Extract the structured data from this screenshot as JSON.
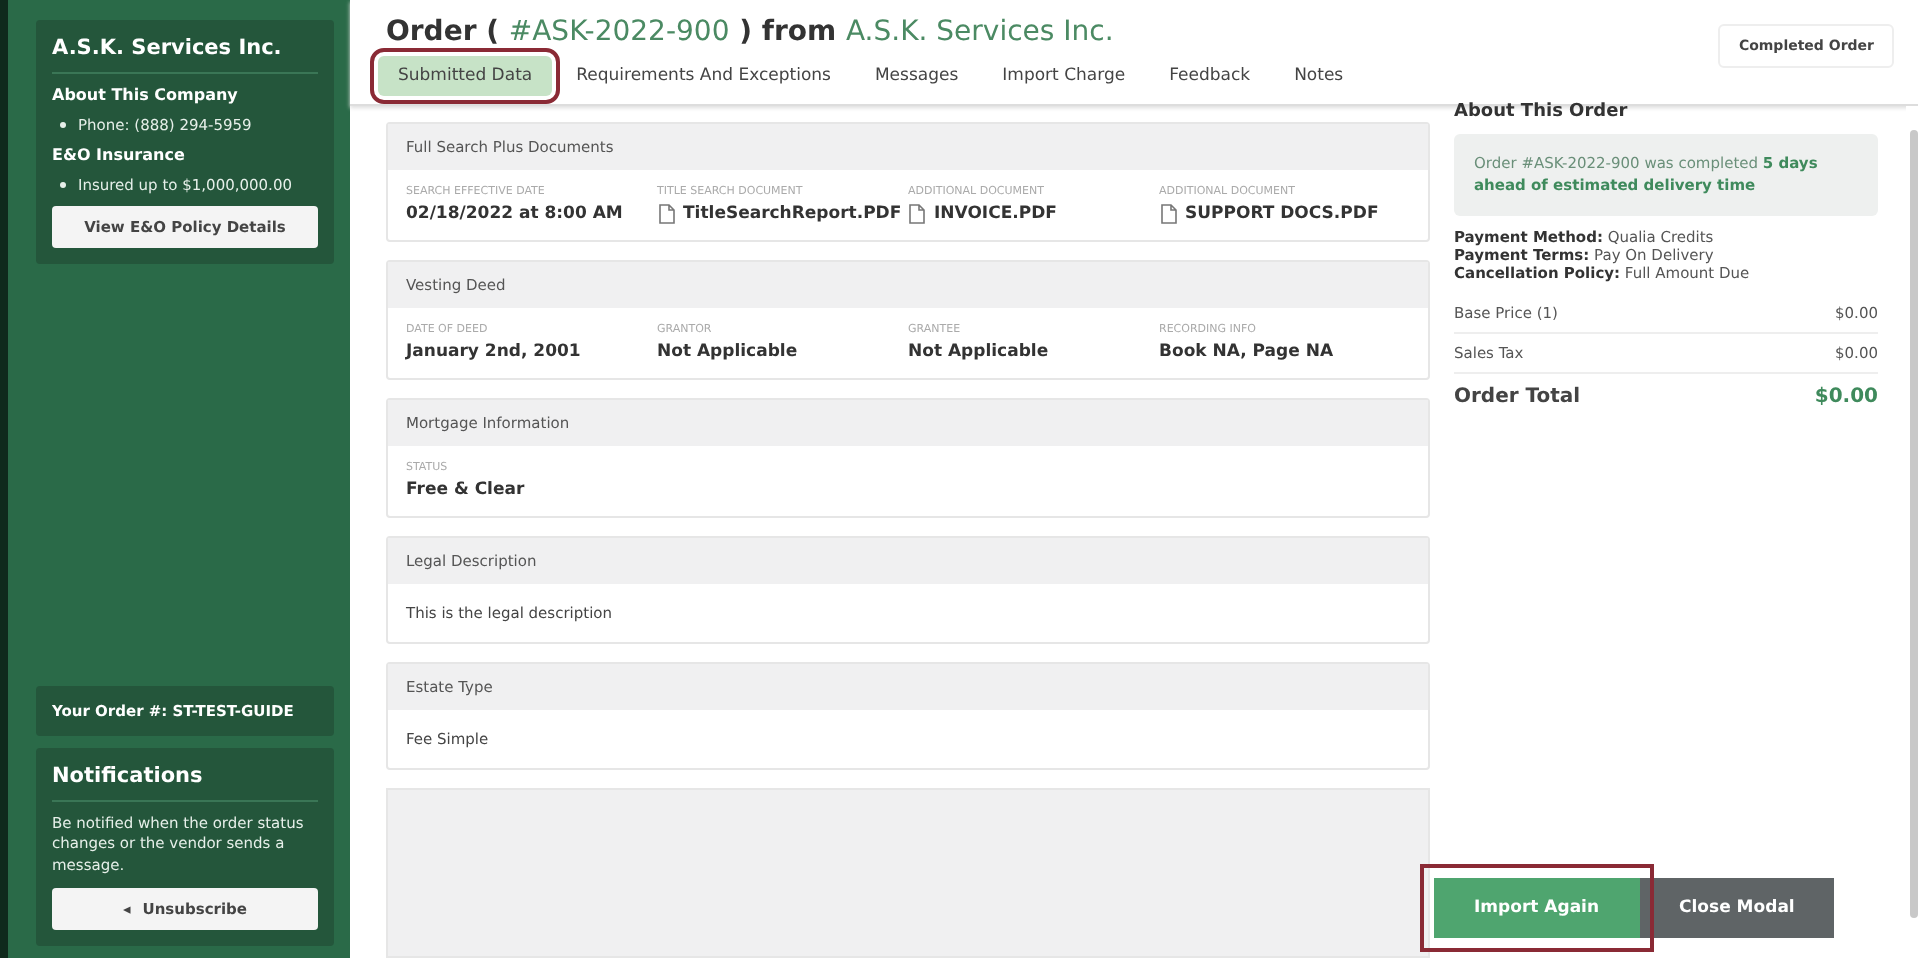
{
  "sidebar": {
    "company": "A.S.K. Services Inc.",
    "sections": [
      {
        "title": "About This Company",
        "items": [
          "Phone: (888) 294-5959"
        ]
      },
      {
        "title": "E&O Insurance",
        "items": [
          "Insured up to $1,000,000.00"
        ]
      }
    ],
    "policy_button": "View E&O Policy Details",
    "your_order": "Your Order #: ST-TEST-GUIDE",
    "notifications": {
      "title": "Notifications",
      "text": "Be notified when the order status changes or the vendor sends a message.",
      "button_icon": "◂",
      "button": "Unsubscribe"
    }
  },
  "header": {
    "title_prefix": "Order (",
    "order_id": "#ASK-2022-900",
    "title_mid": ") from",
    "vendor": "A.S.K. Services Inc.",
    "status": "Completed Order"
  },
  "tabs": [
    {
      "label": "Submitted Data",
      "selected": true,
      "highlighted": true
    },
    {
      "label": "Requirements And Exceptions",
      "selected": false,
      "highlighted": false
    },
    {
      "label": "Messages",
      "selected": false,
      "highlighted": false
    },
    {
      "label": "Import Charge",
      "selected": false,
      "highlighted": false
    },
    {
      "label": "Feedback",
      "selected": false,
      "highlighted": false
    },
    {
      "label": "Notes",
      "selected": false,
      "highlighted": false
    }
  ],
  "sections": [
    {
      "title": "Full Search Plus Documents",
      "kind": "fields",
      "fields": [
        {
          "label": "SEARCH EFFECTIVE DATE",
          "value": "02/18/2022 at 8:00 AM",
          "file": false
        },
        {
          "label": "TITLE SEARCH DOCUMENT",
          "value": "TitleSearchReport.PDF",
          "file": true
        },
        {
          "label": "ADDITIONAL DOCUMENT",
          "value": "INVOICE.PDF",
          "file": true
        },
        {
          "label": "ADDITIONAL DOCUMENT",
          "value": "SUPPORT DOCS.PDF",
          "file": true
        }
      ]
    },
    {
      "title": "Vesting Deed",
      "kind": "fields",
      "fields": [
        {
          "label": "DATE OF DEED",
          "value": "January 2nd, 2001",
          "file": false
        },
        {
          "label": "GRANTOR",
          "value": "Not Applicable",
          "file": false
        },
        {
          "label": "GRANTEE",
          "value": "Not Applicable",
          "file": false
        },
        {
          "label": "RECORDING INFO",
          "value": "Book NA, Page NA",
          "file": false
        }
      ]
    },
    {
      "title": "Mortgage Information",
      "kind": "fields",
      "fields": [
        {
          "label": "STATUS",
          "value": "Free & Clear",
          "file": false
        }
      ]
    },
    {
      "title": "Legal Description",
      "kind": "text",
      "text": "This is the legal description"
    },
    {
      "title": "Estate Type",
      "kind": "text",
      "text": "Fee Simple"
    }
  ],
  "about": {
    "title": "About This Order",
    "notice": "Order #ASK-2022-900 was completed **5 days ahead of estimated delivery time**",
    "terms": [
      {
        "label": "Payment Method:",
        "value": "Qualia Credits"
      },
      {
        "label": "Payment Terms:",
        "value": "Pay On Delivery"
      },
      {
        "label": "Cancellation Policy:",
        "value": "Full Amount Due"
      }
    ],
    "lines": [
      {
        "label": "Base Price (1)",
        "value": "$0.00"
      },
      {
        "label": "Sales Tax",
        "value": "$0.00"
      }
    ],
    "total_label": "Order Total",
    "total": "$0.00"
  },
  "buttons": [
    {
      "label": "Import Again",
      "kind": "primary",
      "highlighted": true
    },
    {
      "label": "Close Modal",
      "kind": "secondary",
      "highlighted": false
    }
  ]
}
